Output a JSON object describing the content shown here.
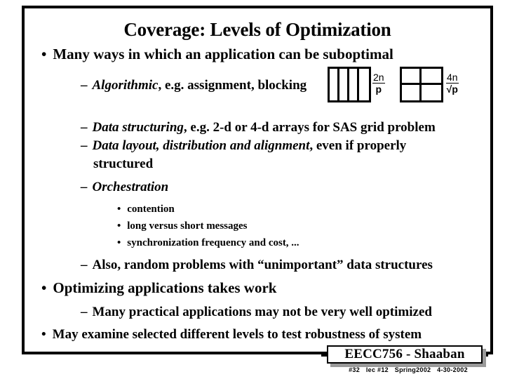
{
  "slide": {
    "title": "Coverage: Levels of Optimization",
    "bullets": {
      "b1": "Many ways in which an application can be suboptimal",
      "b2_algorithmic_em": "Algorithmic",
      "b2_algorithmic_rest": ", e.g. assignment, blocking",
      "b3_data_structuring_em": "Data structuring",
      "b3_data_structuring_rest": ", e.g. 2-d or 4-d arrays for SAS grid problem",
      "b4_data_layout_em": "Data layout, distribution and alignment",
      "b4_data_layout_rest": ", even if properly",
      "b4_data_layout_cont": "structured",
      "b5_orchestration_em": "Orchestration",
      "b6_contention": "contention",
      "b7_long_short": "long versus short messages",
      "b8_sync": "synchronization frequency and cost, ...",
      "b9_also_random": "Also, random problems with “unimportant” data structures",
      "b10_optimizing": "Optimizing applications takes work",
      "b11_many_practical": "Many practical applications may not be very well optimized",
      "b12_may_examine": "May examine selected different levels to test robustness of system"
    }
  },
  "figures": {
    "columns_grid": {
      "label": "block-column-partition-grid",
      "cells": 4
    },
    "quadrants_grid": {
      "label": "block-quadrant-partition-grid",
      "cells": 4
    },
    "fraction_left": {
      "numerator": "2n",
      "denominator": "p"
    },
    "fraction_right": {
      "numerator": "4n",
      "denominator": "√p"
    }
  },
  "footer": {
    "badge": "EECC756 - Shaaban",
    "slide_number": "#32",
    "lecture": "lec #12",
    "term": "Spring2002",
    "date": "4-30-2002"
  },
  "colors": {
    "text": "#000000",
    "background": "#ffffff",
    "badge_shadow": "#9a9a9a"
  }
}
